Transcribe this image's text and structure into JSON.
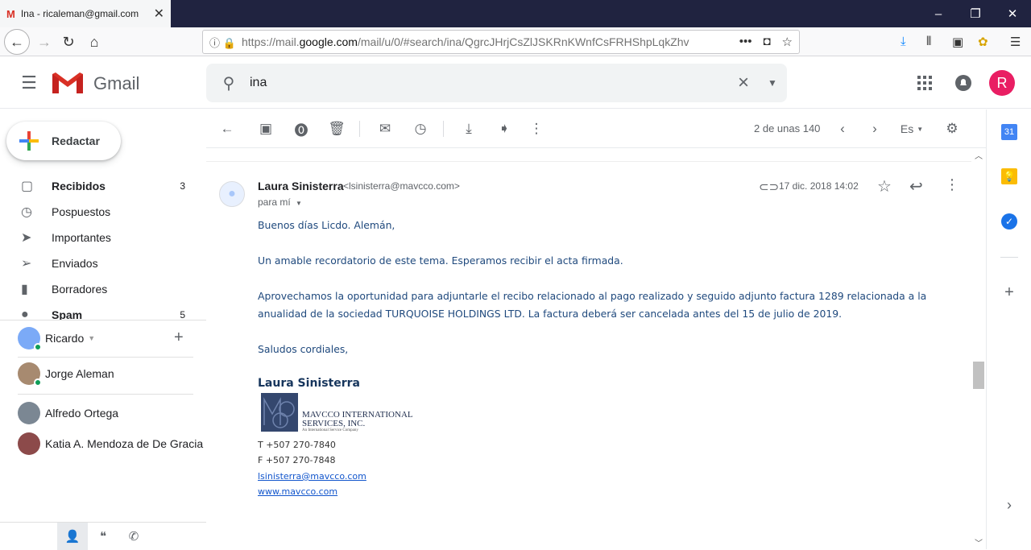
{
  "browser": {
    "tab_title": "Ina - ricaleman@gmail.com",
    "tab_favicon": "M",
    "url_prefix": "https://mail.",
    "url_domain": "google.com",
    "url_rest": "/mail/u/0/#search/ina/QgrcJHrjCsZlJSKRnKWnfCsFRHShpLqkZhv",
    "window_controls": [
      "–",
      "❐",
      "✕"
    ]
  },
  "gmail": {
    "logo_text": "Gmail",
    "search_value": "ina",
    "avatar_letter": "R",
    "brand_colors": {
      "red": "#ea4335",
      "blue": "#4285f4",
      "green": "#34a853",
      "yellow": "#fbbc04"
    }
  },
  "sidebar": {
    "compose_label": "Redactar",
    "items": [
      {
        "icon": "inbox-icon",
        "glyph": "▢",
        "label": "Recibidos",
        "count": "3",
        "bold": true
      },
      {
        "icon": "snooze-icon",
        "glyph": "◷",
        "label": "Pospuestos",
        "count": "",
        "bold": false
      },
      {
        "icon": "important-icon",
        "glyph": "➤",
        "label": "Importantes",
        "count": "",
        "bold": false
      },
      {
        "icon": "sent-icon",
        "glyph": "➢",
        "label": "Enviados",
        "count": "",
        "bold": false
      },
      {
        "icon": "drafts-icon",
        "glyph": "▮",
        "label": "Borradores",
        "count": "",
        "bold": false
      },
      {
        "icon": "spam-icon",
        "glyph": "●",
        "label": "Spam",
        "count": "5",
        "bold": true
      }
    ]
  },
  "hangouts": {
    "user_name": "Ricardo",
    "contacts": [
      "Jorge Aleman",
      "Alfredo Ortega",
      "Katia A. Mendoza de De Gracia"
    ]
  },
  "toolbar": {
    "pager": "2 de unas 140",
    "lang": "Es"
  },
  "email": {
    "sender_name": "Laura Sinisterra",
    "sender_email": "<lsinisterra@mavcco.com>",
    "to_label": "para mí",
    "date": "17 dic. 2018 14:02",
    "body": [
      "Buenos días Licdo. Alemán,",
      "Un amable recordatorio de este tema. Esperamos recibir el acta firmada.",
      "Aprovechamos la oportunidad para adjuntarle el recibo relacionado al pago realizado y seguido adjunto factura 1289 relacionada a la anualidad de la sociedad TURQUOISE HOLDINGS LTD.   La factura deberá ser cancelada antes del 15 de julio de 2019.",
      "Saludos cordiales,"
    ],
    "signature": {
      "name": "Laura Sinisterra",
      "company_line1": "MAVCCO INTERNATIONAL",
      "company_line2": "SERVICES, INC.",
      "company_tagline": "An International Service Company",
      "phone": "T +507 270-7840",
      "fax": "F +507 270-7848",
      "email_link": "lsinisterra@mavcco.com",
      "web_link": "www.mavcco.com"
    }
  },
  "side_panel": {
    "calendar_day": "31"
  }
}
